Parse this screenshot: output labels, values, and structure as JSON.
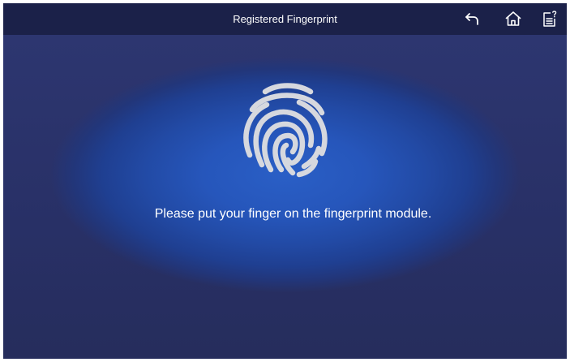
{
  "header": {
    "title": "Registered Fingerprint",
    "icons": {
      "back": "back-arrow-icon",
      "home": "home-icon",
      "help": "help-document-icon"
    }
  },
  "main": {
    "fingerprint_icon": "fingerprint-icon",
    "prompt": "Please put your finger on the fingerprint module."
  },
  "colors": {
    "topbar": "#1b2149",
    "background": "#2a3266",
    "glow": "#2a5fc6",
    "icon": "#d6d8de"
  }
}
